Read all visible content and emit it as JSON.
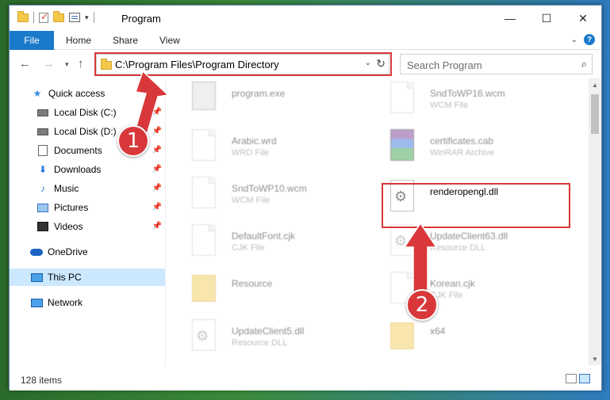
{
  "window": {
    "title": "Program",
    "controls": {
      "minimize": "—",
      "maximize": "☐",
      "close": "✕"
    }
  },
  "ribbon": {
    "tabs": [
      "File",
      "Home",
      "Share",
      "View"
    ]
  },
  "navbar": {
    "address": "C:\\Program Files\\Program Directory",
    "search_placeholder": "Search Program"
  },
  "sidebar": {
    "items": [
      {
        "label": "Quick access",
        "icon": "star-icon"
      },
      {
        "label": "Local Disk (C:)",
        "icon": "disk-icon",
        "pinned": true
      },
      {
        "label": "Local Disk (D:)",
        "icon": "disk-icon",
        "pinned": true
      },
      {
        "label": "Documents",
        "icon": "document-icon",
        "pinned": true
      },
      {
        "label": "Downloads",
        "icon": "download-icon",
        "pinned": true
      },
      {
        "label": "Music",
        "icon": "music-icon",
        "pinned": true
      },
      {
        "label": "Pictures",
        "icon": "picture-icon",
        "pinned": true
      },
      {
        "label": "Videos",
        "icon": "video-icon",
        "pinned": true
      },
      {
        "label": "OneDrive",
        "icon": "cloud-icon"
      },
      {
        "label": "This PC",
        "icon": "computer-icon",
        "selected": true
      },
      {
        "label": "Network",
        "icon": "network-icon"
      }
    ]
  },
  "files": [
    {
      "name": "program.exe",
      "type": "",
      "icon": "exe"
    },
    {
      "name": "SndToWP16.wcm",
      "type": "WCM File",
      "icon": "blank"
    },
    {
      "name": "Arabic.wrd",
      "type": "WRD File",
      "icon": "blank"
    },
    {
      "name": "certificates.cab",
      "type": "WinRAR Archive",
      "icon": "archive"
    },
    {
      "name": "SndToWP10.wcm",
      "type": "WCM File",
      "icon": "blank"
    },
    {
      "name": "renderopengl.dll",
      "type": "",
      "icon": "gear"
    },
    {
      "name": "DefaultFont.cjk",
      "type": "CJK File",
      "icon": "blank"
    },
    {
      "name": "UpdateClient63.dll",
      "type": "Resource DLL",
      "icon": "gear"
    },
    {
      "name": "Resource",
      "type": "",
      "icon": "folder"
    },
    {
      "name": "Korean.cjk",
      "type": "CJK File",
      "icon": "blank"
    },
    {
      "name": "UpdateClient5.dll",
      "type": "Resource DLL",
      "icon": "gear"
    },
    {
      "name": "x64",
      "type": "",
      "icon": "folder"
    }
  ],
  "status": {
    "item_count": "128 items"
  },
  "annotations": {
    "badge1": "1",
    "badge2": "2",
    "color": "#d8383a"
  },
  "colors": {
    "accent": "#1979ca",
    "selection": "#cce8ff",
    "highlight": "#d8383a"
  }
}
